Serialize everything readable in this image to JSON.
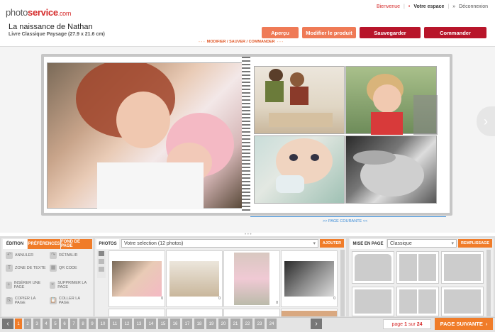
{
  "header": {
    "logo_main": "photo",
    "logo_bold": "service",
    "logo_dom": ".com",
    "links": [
      "Bienvenue",
      "Votre espace",
      "Déconnexion"
    ],
    "title": "La naissance de Nathan",
    "subtitle": "Livre Classique Paysage (27.9 x 21.6 cm)",
    "buttons": {
      "apercu": "Aperçu",
      "modifier": "Modifier le produit",
      "sauvegarder": "Sauvegarder",
      "commander": "Commander"
    },
    "mod_line": "MODIFIER / SAUVER / COMMANDER"
  },
  "editor": {
    "page_courante": "PAGE COURANTE"
  },
  "edition": {
    "tabs": [
      "ÉDITION",
      "PRÉFÉRENCES",
      "FOND DE PAGE"
    ],
    "tools": [
      {
        "label": "ANNULER",
        "icon": "undo-icon"
      },
      {
        "label": "RÉTABLIR",
        "icon": "redo-icon"
      },
      {
        "label": "ZONE DE TEXTE",
        "icon": "text-icon"
      },
      {
        "label": "QR CODE",
        "icon": "qr-icon"
      },
      {
        "label": "INSÉRER UNE PAGE",
        "icon": "insert-page-icon"
      },
      {
        "label": "SUPPRIMER LA PAGE",
        "icon": "delete-page-icon"
      },
      {
        "label": "COPIER LA PAGE",
        "icon": "copy-page-icon"
      },
      {
        "label": "COLLER LA PAGE",
        "icon": "paste-page-icon"
      }
    ]
  },
  "photos": {
    "label": "PHOTOS",
    "select": "Votre selection (12 photos)",
    "add": "AJOUTER",
    "counts": [
      "0",
      "0",
      "0",
      "0"
    ]
  },
  "mise": {
    "label": "MISE EN PAGE",
    "select": "Classique",
    "fill": "REMPLISSAGE"
  },
  "pager": {
    "pages": [
      "1",
      "2",
      "3",
      "4",
      "5",
      "6",
      "7",
      "8",
      "9",
      "10",
      "11",
      "12",
      "13",
      "14",
      "15",
      "16",
      "17",
      "18",
      "19",
      "20",
      "21",
      "22",
      "23",
      "24"
    ],
    "current": "1",
    "page_label": "page",
    "sur": "sur",
    "total": "24",
    "next": "PAGE SUIVANTE"
  },
  "colors": {
    "accent": "#f07c29",
    "brand": "#d52b2b",
    "dark_red": "#b8152a"
  }
}
